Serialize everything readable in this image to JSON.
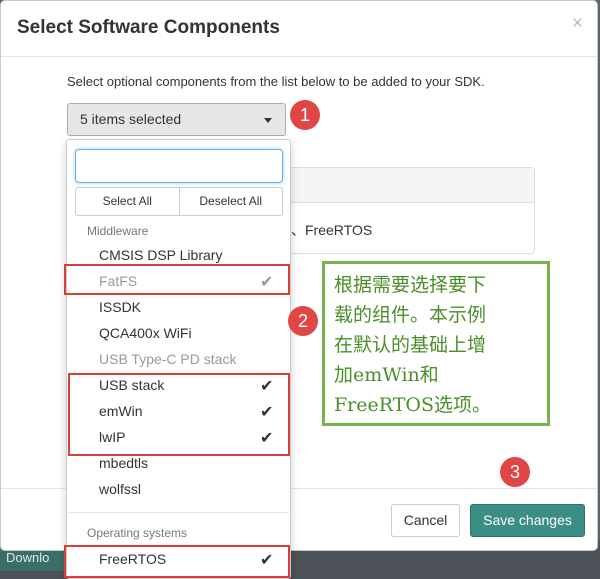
{
  "background": {
    "download_label": "Downlo"
  },
  "modal": {
    "title": "Select Software Components",
    "close_glyph": "×",
    "description": "Select optional components from the list below to be added to your SDK.",
    "selection_button": "5 items selected",
    "panel_text": "、FreeRTOS",
    "cancel_label": "Cancel",
    "save_label": "Save changes"
  },
  "dropdown": {
    "search_value": "",
    "select_all": "Select All",
    "deselect_all": "Deselect All",
    "groups": [
      {
        "label": "Middleware",
        "items": [
          {
            "label": "CMSIS DSP Library",
            "checked": false,
            "disabled": false
          },
          {
            "label": "FatFS",
            "checked": true,
            "disabled": true
          },
          {
            "label": "ISSDK",
            "checked": false,
            "disabled": false
          },
          {
            "label": "QCA400x WiFi",
            "checked": false,
            "disabled": false
          },
          {
            "label": "USB Type-C PD stack",
            "checked": false,
            "disabled": true
          },
          {
            "label": "USB stack",
            "checked": true,
            "disabled": false
          },
          {
            "label": "emWin",
            "checked": true,
            "disabled": false
          },
          {
            "label": "lwIP",
            "checked": true,
            "disabled": false
          },
          {
            "label": "mbedtls",
            "checked": false,
            "disabled": false
          },
          {
            "label": "wolfssl",
            "checked": false,
            "disabled": false
          }
        ]
      },
      {
        "label": "Operating systems",
        "items": [
          {
            "label": "FreeRTOS",
            "checked": true,
            "disabled": false
          }
        ]
      }
    ],
    "check_glyph": "✔"
  },
  "annotations": {
    "step1": "1",
    "step2": "2",
    "step3": "3",
    "note_lines": [
      "根据需要选择要下",
      "载的组件。本示例",
      "在默认的基础上增",
      "加emWin和",
      "FreeRTOS选项。"
    ]
  },
  "colors": {
    "accent": "#3a8e84",
    "highlight_box": "#d6403a",
    "step_circle": "#e04646",
    "note_border": "#76b24f",
    "note_text": "#4a8f2a"
  }
}
